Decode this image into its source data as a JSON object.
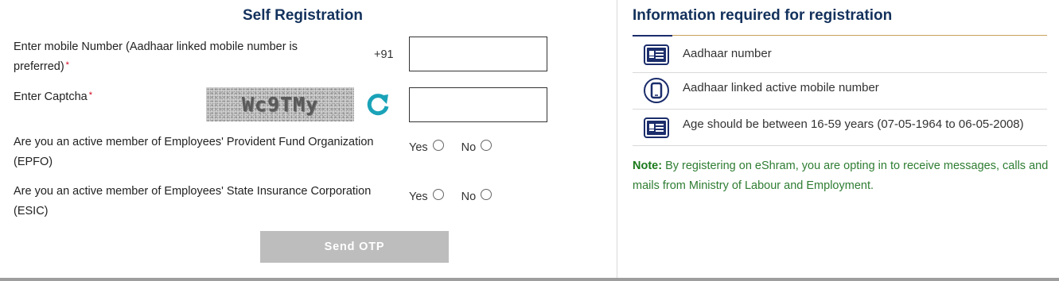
{
  "registration": {
    "title": "Self Registration",
    "mobile": {
      "label": "Enter mobile Number (Aadhaar linked mobile number is preferred)",
      "required_mark": "*",
      "prefix": "+91",
      "value": ""
    },
    "captcha": {
      "label": "Enter Captcha",
      "required_mark": "*",
      "image_text": "Wc9TMy",
      "value": ""
    },
    "epfo": {
      "question": "Are you an active member of Employees' Provident Fund Organization (EPFO)",
      "yes_label": "Yes",
      "no_label": "No",
      "selected": null
    },
    "esic": {
      "question": "Are you an active member of Employees' State Insurance Corporation (ESIC)",
      "yes_label": "Yes",
      "no_label": "No",
      "selected": null
    },
    "send_otp_label": "Send OTP"
  },
  "info": {
    "title": "Information required for registration",
    "items": [
      {
        "icon": "id-card-icon",
        "text": "Aadhaar number"
      },
      {
        "icon": "mobile-phone-icon",
        "text": "Aadhaar linked active mobile number"
      },
      {
        "icon": "id-card-icon",
        "text": "Age should be between 16-59 years (07-05-1964 to 06-05-2008)"
      }
    ],
    "note_prefix": "Note:",
    "note_text": " By registering on eShram, you are opting in to receive messages, calls and mails from Ministry of Labour and Employment."
  },
  "colors": {
    "title": "#13315c",
    "icon": "#1b2d6b",
    "refresh": "#1aa3b8",
    "note": "#2e7d32",
    "button_disabled": "#bdbdbd"
  }
}
